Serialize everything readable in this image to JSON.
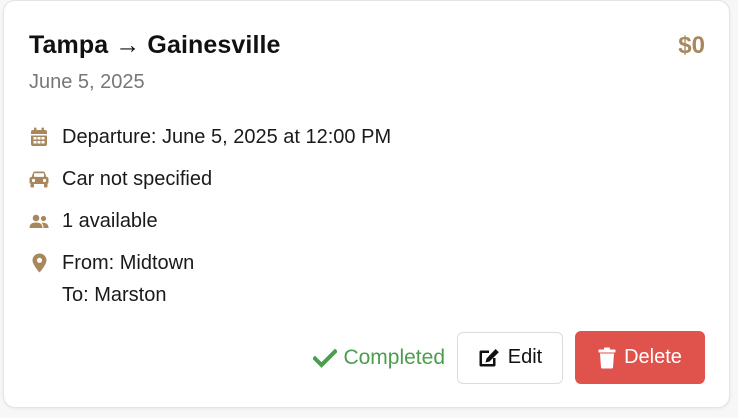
{
  "ride": {
    "title": "Tampa → Gainesville",
    "price": "$0",
    "date": "June 5, 2025",
    "departure": "Departure: June 5, 2025 at 12:00 PM",
    "car": "Car not specified",
    "seats": "1 available",
    "from": "From: Midtown",
    "to": "To: Marston"
  },
  "status": {
    "label": "Completed",
    "icon": "check-icon"
  },
  "actions": {
    "edit_label": "Edit",
    "delete_label": "Delete"
  },
  "icons": {
    "departure": "calendar-icon",
    "car": "car-icon",
    "seats": "users-icon",
    "location": "map-pin-icon",
    "edit": "edit-icon",
    "delete": "trash-icon"
  },
  "colors": {
    "accent": "#a8875d",
    "success": "#4a9e4d",
    "danger": "#e0524c"
  }
}
